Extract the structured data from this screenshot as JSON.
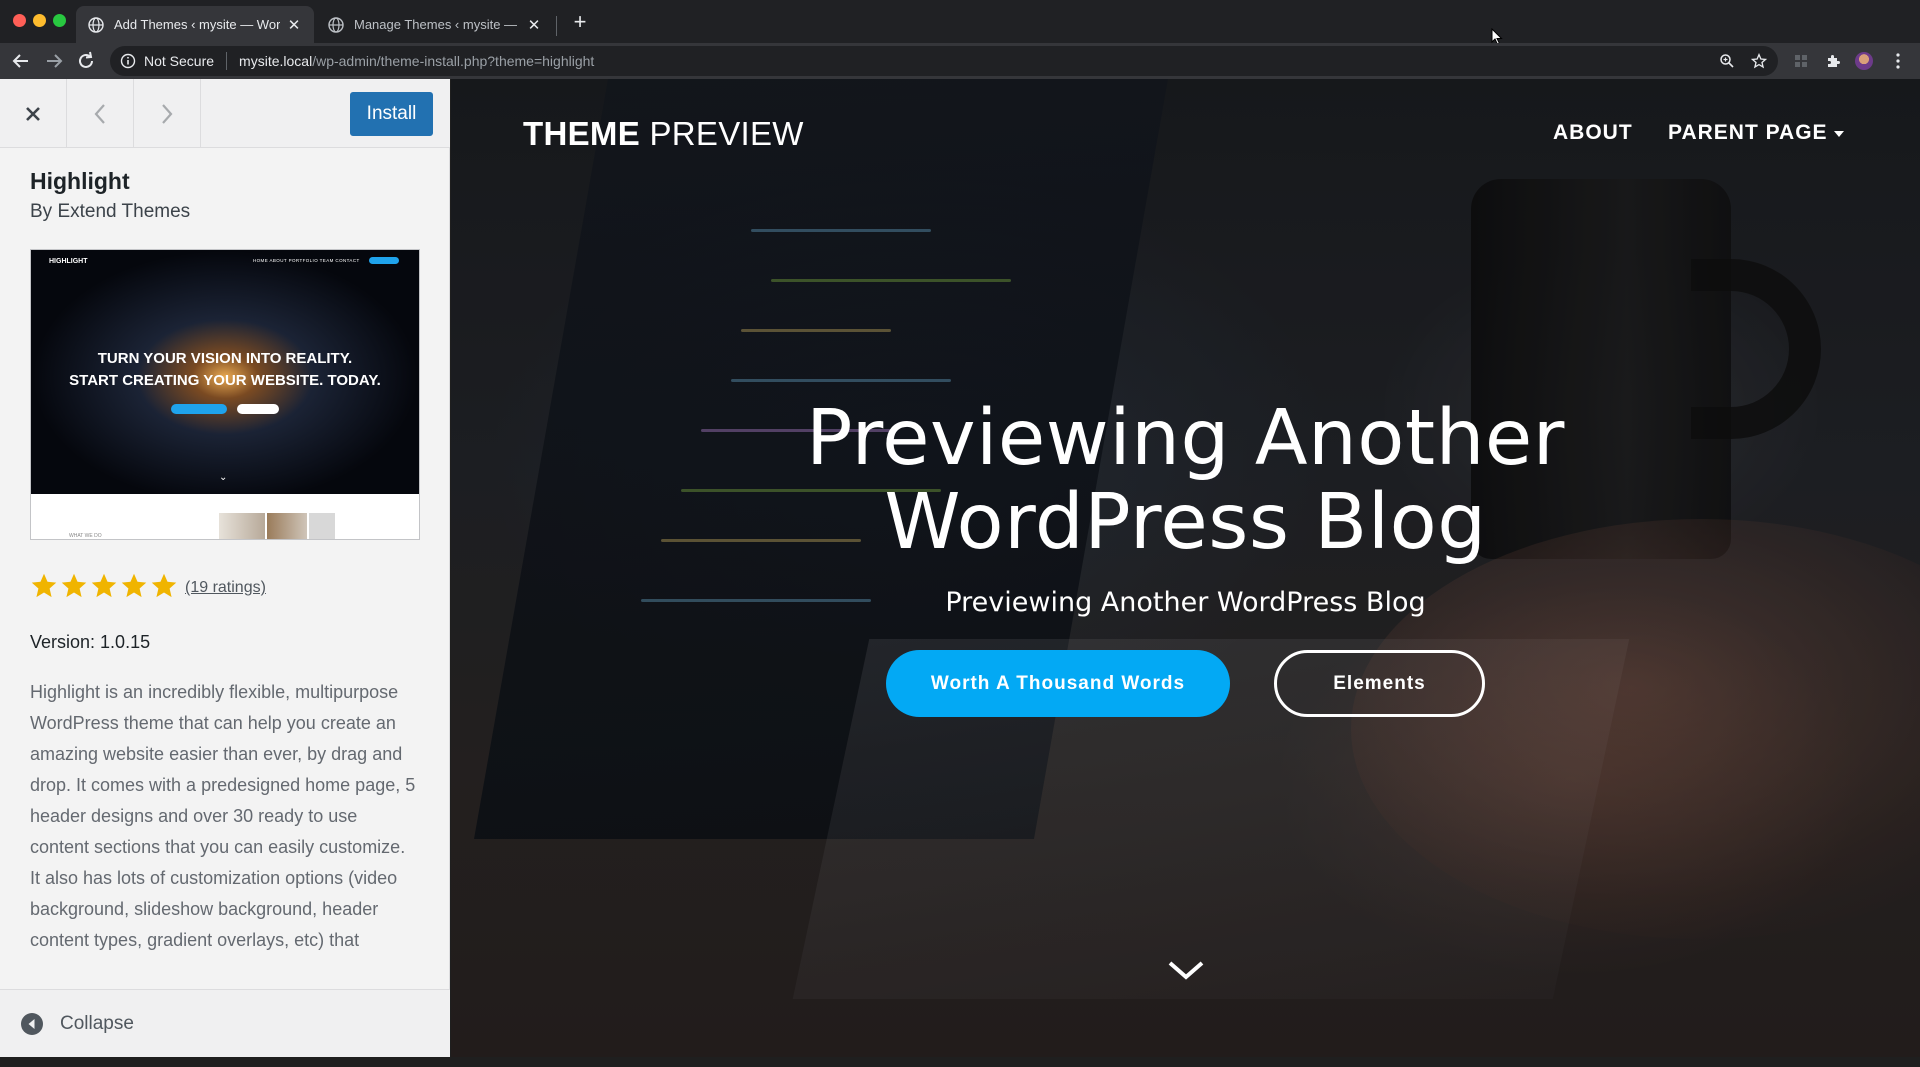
{
  "browser": {
    "tabs": [
      {
        "title": "Add Themes ‹ mysite — WordPress",
        "active": true
      },
      {
        "title": "Manage Themes ‹ mysite — WordPress",
        "active": false
      }
    ],
    "address": {
      "security_label": "Not Secure",
      "host": "mysite.local",
      "path": "/wp-admin/theme-install.php?theme=highlight"
    }
  },
  "panel": {
    "install_label": "Install",
    "theme_name": "Highlight",
    "author": "By Extend Themes",
    "screenshot": {
      "logo": "HIGHLIGHT",
      "nav": "HOME   ABOUT   PORTFOLIO   TEAM   CONTACT",
      "headline_line1": "TURN YOUR VISION INTO REALITY.",
      "headline_line2": "START CREATING YOUR WEBSITE. TODAY.",
      "section_label": "WHAT WE DO"
    },
    "rating": {
      "stars": 5,
      "max": 5,
      "count_label": "(19 ratings)"
    },
    "version": "Version: 1.0.15",
    "description": "Highlight is an incredibly flexible, multipurpose WordPress theme that can help you create an amazing website easier than ever, by drag and drop. It comes with a predesigned home page, 5 header designs and over 30 ready to use content sections that you can easily customize. It also has lots of customization options (video background, slideshow background, header content types, gradient overlays, etc) that",
    "collapse_label": "Collapse"
  },
  "preview": {
    "site_title_bold": "THEME",
    "site_title_light": "PREVIEW",
    "nav": {
      "about": "ABOUT",
      "parent": "PARENT PAGE"
    },
    "hero_title_line1": "Previewing Another",
    "hero_title_line2": "WordPress Blog",
    "hero_subtitle": "Previewing Another WordPress Blog",
    "primary_button": "Worth A Thousand Words",
    "secondary_button": "Elements"
  },
  "colors": {
    "install_blue": "#2271b1",
    "hero_button_blue": "#03a9f4",
    "star_gold": "#f0b400"
  },
  "icons": [
    "globe-icon",
    "close-icon",
    "plus-icon",
    "back-icon",
    "forward-icon",
    "reload-icon",
    "info-icon",
    "zoom-icon",
    "star-bookmark-icon",
    "extensions-icon",
    "menu-icon",
    "chevron-left-icon",
    "chevron-right-icon",
    "collapse-icon",
    "chevron-down-icon"
  ]
}
